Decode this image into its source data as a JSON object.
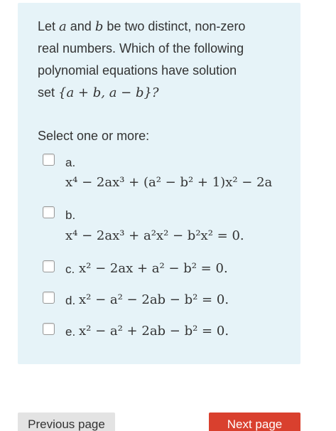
{
  "question": {
    "line1_pre": "Let ",
    "var_a": "a",
    "line1_mid": " and ",
    "var_b": "b",
    "line1_post": " be two distinct, non-zero",
    "line2": "real numbers. Which of the following",
    "line3": "polynomial equations have solution",
    "line4_pre": "set ",
    "line4_math": "{a + b,  a − b}?"
  },
  "prompt": "Select one or more:",
  "options": [
    {
      "letter": "a.",
      "math": "x⁴ − 2ax³ + (a² − b² + 1)x² − 2a"
    },
    {
      "letter": "b.",
      "math": "x⁴ − 2ax³ + a²x² − b²x² = 0."
    },
    {
      "letter": "c.",
      "math": "x² − 2ax + a² − b² = 0."
    },
    {
      "letter": "d.",
      "math": "x² − a² − 2ab − b² = 0."
    },
    {
      "letter": "e.",
      "math": "x² − a² + 2ab − b² = 0."
    }
  ],
  "buttons": {
    "previous": "Previous page",
    "next": "Next page"
  },
  "colors": {
    "question_bg": "#e6f3f8",
    "next_button": "#d9402e",
    "prev_button": "#e3e3e3"
  }
}
